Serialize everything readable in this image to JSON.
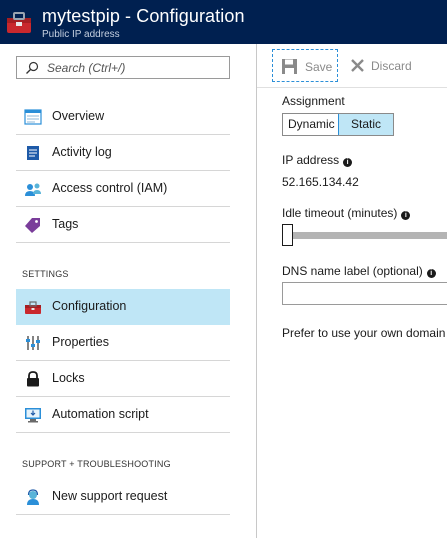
{
  "header": {
    "title": "mytestpip - Configuration",
    "subtitle": "Public IP address",
    "icon": "toolbox-icon",
    "background": "#002050"
  },
  "search": {
    "placeholder": "Search (Ctrl+/)",
    "value": ""
  },
  "sidebar": {
    "items": [
      {
        "label": "Overview",
        "icon": "overview-icon",
        "active": false
      },
      {
        "label": "Activity log",
        "icon": "activity-log-icon",
        "active": false
      },
      {
        "label": "Access control (IAM)",
        "icon": "iam-icon",
        "active": false
      },
      {
        "label": "Tags",
        "icon": "tag-icon",
        "active": false
      }
    ],
    "settings_label": "SETTINGS",
    "settings_items": [
      {
        "label": "Configuration",
        "icon": "toolbox-icon",
        "active": true
      },
      {
        "label": "Properties",
        "icon": "properties-icon",
        "active": false
      },
      {
        "label": "Locks",
        "icon": "lock-icon",
        "active": false
      },
      {
        "label": "Automation script",
        "icon": "automation-script-icon",
        "active": false
      }
    ],
    "support_label": "SUPPORT + TROUBLESHOOTING",
    "support_items": [
      {
        "label": "New support request",
        "icon": "support-icon",
        "active": false
      }
    ]
  },
  "toolbar": {
    "save_label": "Save",
    "discard_label": "Discard"
  },
  "form": {
    "assignment_label": "Assignment",
    "assignment_options": [
      "Dynamic",
      "Static"
    ],
    "assignment_selected": "Static",
    "ip_label": "IP address",
    "ip_value": "52.165.134.42",
    "idle_label": "Idle timeout (minutes)",
    "dns_label": "DNS name label (optional)",
    "dns_value": "",
    "note": "Prefer to use your own domain"
  },
  "colors": {
    "accent": "#2b8fd8",
    "selected_bg": "#bfe6f6",
    "header_bg": "#002050"
  }
}
